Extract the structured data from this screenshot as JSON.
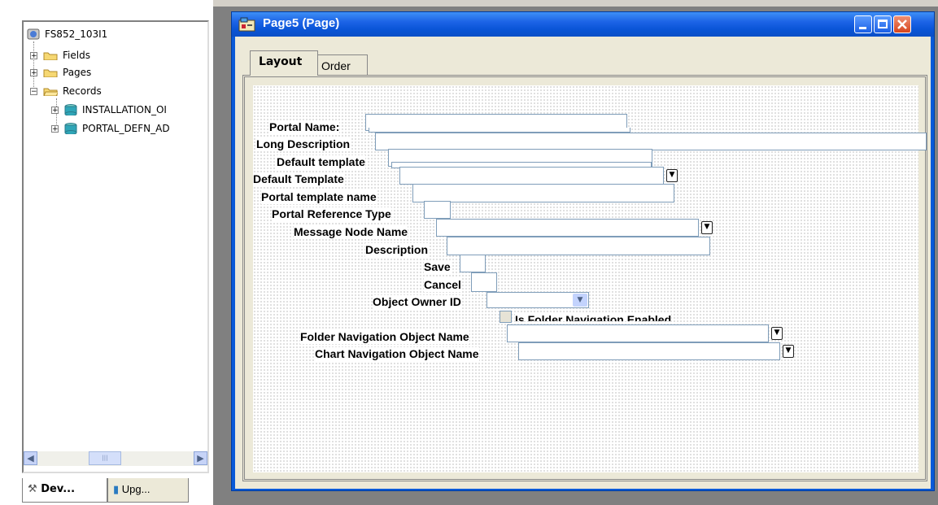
{
  "project_tree": {
    "root": "FS852_103I1",
    "items": [
      {
        "label": "Fields",
        "expander": "+"
      },
      {
        "label": "Pages",
        "expander": "+"
      },
      {
        "label": "Records",
        "expander": "-"
      }
    ],
    "records": [
      "INSTALLATION_OI",
      "PORTAL_DEFN_AD"
    ]
  },
  "bottom_tabs": [
    "Dev...",
    "Upg..."
  ],
  "window": {
    "title": "Page5 (Page)"
  },
  "tabs": [
    "Layout",
    "Order"
  ],
  "page_fields": {
    "portal_name": "Portal Name:",
    "long_description": "Long Description",
    "default_template_1": "Default template",
    "default_template_2": "Default Template",
    "portal_template_name": "Portal template name",
    "portal_reference_type": "Portal Reference Type",
    "message_node_name": "Message Node Name",
    "description": "Description",
    "save": "Save",
    "cancel": "Cancel",
    "object_owner_id": "Object Owner ID",
    "is_folder_navigation_enabled": "Is Folder Navigation Enabled",
    "folder_navigation_object_name": "Folder Navigation Object Name",
    "chart_navigation_object_name": "Chart Navigation Object Name"
  },
  "icons": [
    "database-project-icon",
    "folder-icon",
    "record-icon",
    "page-icon",
    "dropdown-arrow-icon",
    "minimize-icon",
    "maximize-icon",
    "close-icon"
  ],
  "colors": {
    "titlebar": "#0a55d7",
    "workspace": "#808080",
    "close": "#d6451d"
  }
}
